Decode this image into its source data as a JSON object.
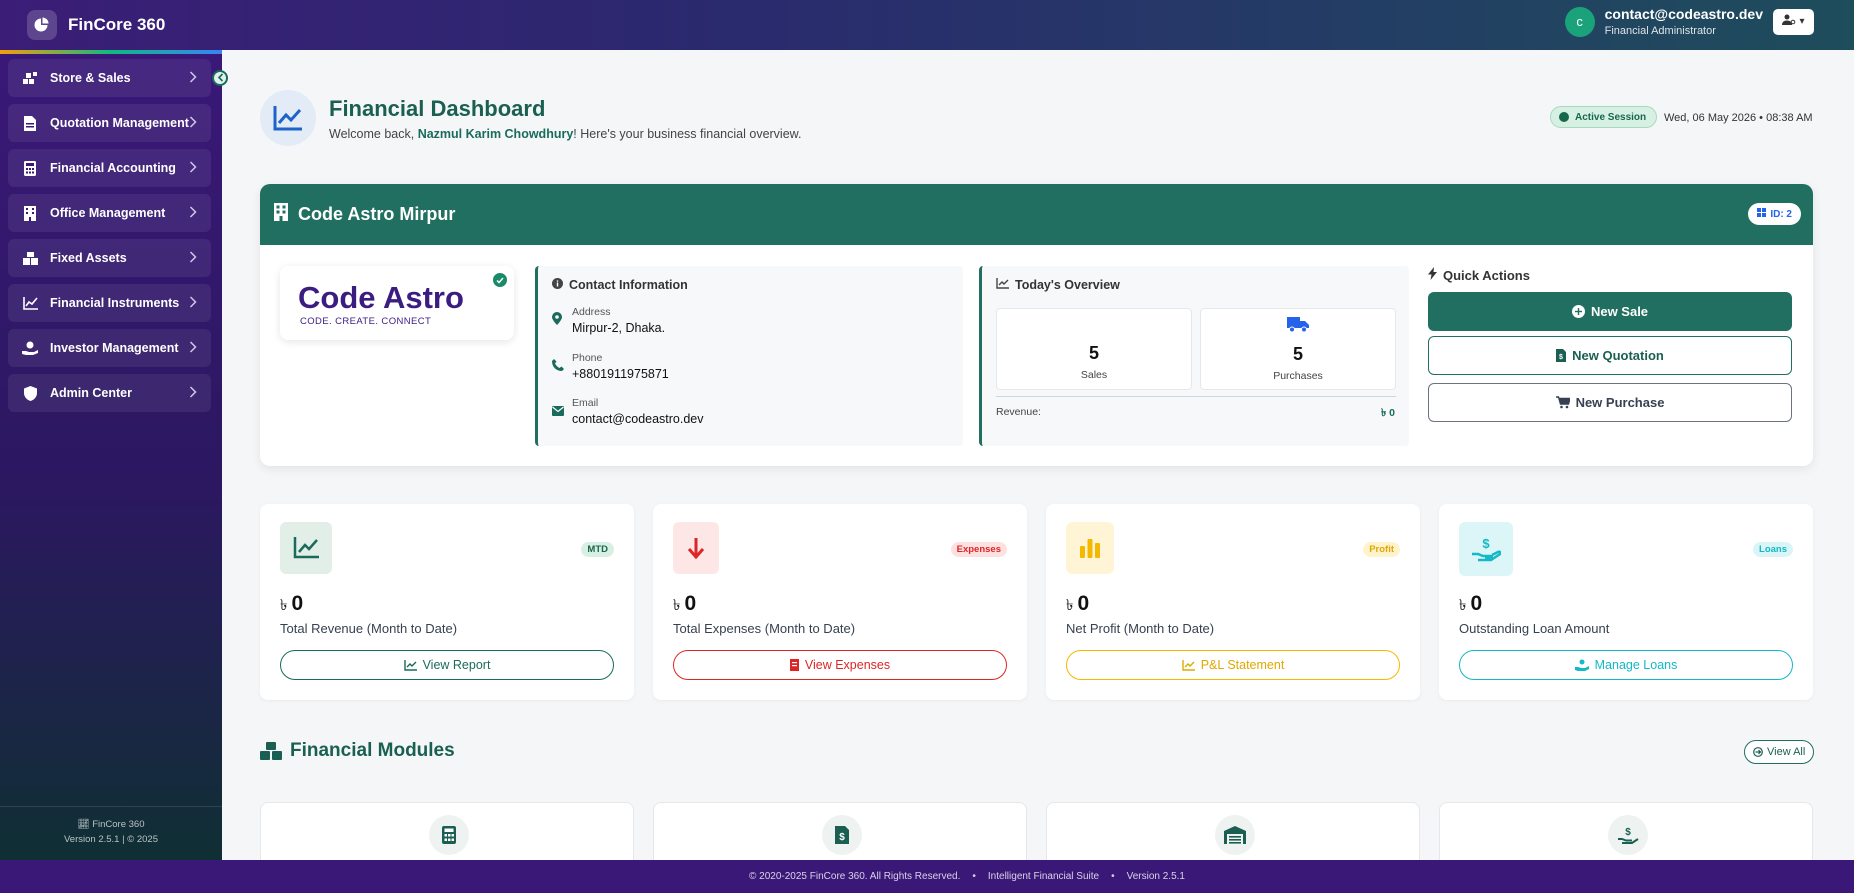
{
  "app": {
    "name": "FinCore 360"
  },
  "user": {
    "initial": "c",
    "email": "contact@codeastro.dev",
    "role": "Financial Administrator"
  },
  "sidebar": {
    "items": [
      {
        "label": "Store & Sales",
        "icon": "store-icon"
      },
      {
        "label": "Quotation Management",
        "icon": "file-invoice-icon"
      },
      {
        "label": "Financial Accounting",
        "icon": "calculator-icon"
      },
      {
        "label": "Office Management",
        "icon": "building-icon"
      },
      {
        "label": "Fixed Assets",
        "icon": "boxes-icon"
      },
      {
        "label": "Financial Instruments",
        "icon": "chart-line-icon"
      },
      {
        "label": "Investor Management",
        "icon": "hand-holding-dollar-icon"
      },
      {
        "label": "Admin Center",
        "icon": "shield-icon"
      }
    ],
    "footer_name": "FinCore 360",
    "footer_version": "Version 2.5.1 | © 2025"
  },
  "header": {
    "title": "Financial Dashboard",
    "welcome_prefix": "Welcome back,",
    "user_name": "Nazmul Karim Chowdhury",
    "welcome_suffix": "! Here's your business financial overview.",
    "session_badge": "Active Session",
    "datetime": "Wed, 06 May 2026 • 08:38 AM"
  },
  "company": {
    "name": "Code Astro Mirpur",
    "id_badge": "ID: 2",
    "logo_text": "Code Astro",
    "logo_tagline": "CODE. CREATE. CONNECT",
    "contact": {
      "title": "Contact Information",
      "address_label": "Address",
      "address": "Mirpur-2, Dhaka.",
      "phone_label": "Phone",
      "phone": "+8801911975871",
      "email_label": "Email",
      "email": "contact@codeastro.dev"
    },
    "overview": {
      "title": "Today's Overview",
      "sales_value": "5",
      "sales_label": "Sales",
      "purchases_value": "5",
      "purchases_label": "Purchases",
      "revenue_label": "Revenue:",
      "revenue_value": "৳ 0"
    },
    "quick_actions": {
      "title": "Quick Actions",
      "new_sale": "New Sale",
      "new_quotation": "New Quotation",
      "new_purchase": "New Purchase"
    }
  },
  "stats": [
    {
      "badge": "MTD",
      "currency": "৳",
      "value": "0",
      "label": "Total Revenue (Month to Date)",
      "button": "View Report",
      "color": "#1a6b5c"
    },
    {
      "badge": "Expenses",
      "currency": "৳",
      "value": "0",
      "label": "Total Expenses (Month to Date)",
      "button": "View Expenses",
      "color": "#dc2626"
    },
    {
      "badge": "Profit",
      "currency": "৳",
      "value": "0",
      "label": "Net Profit (Month to Date)",
      "button": "P&L Statement",
      "color": "#f5b800"
    },
    {
      "badge": "Loans",
      "currency": "৳",
      "value": "0",
      "label": "Outstanding Loan Amount",
      "button": "Manage Loans",
      "color": "#14b8c6"
    }
  ],
  "modules": {
    "title": "Financial Modules",
    "view_all": "View All"
  },
  "footer": {
    "copyright": "© 2020-2025 FinCore 360. All Rights Reserved.",
    "suite": "Intelligent Financial Suite",
    "version": "Version 2.5.1"
  }
}
